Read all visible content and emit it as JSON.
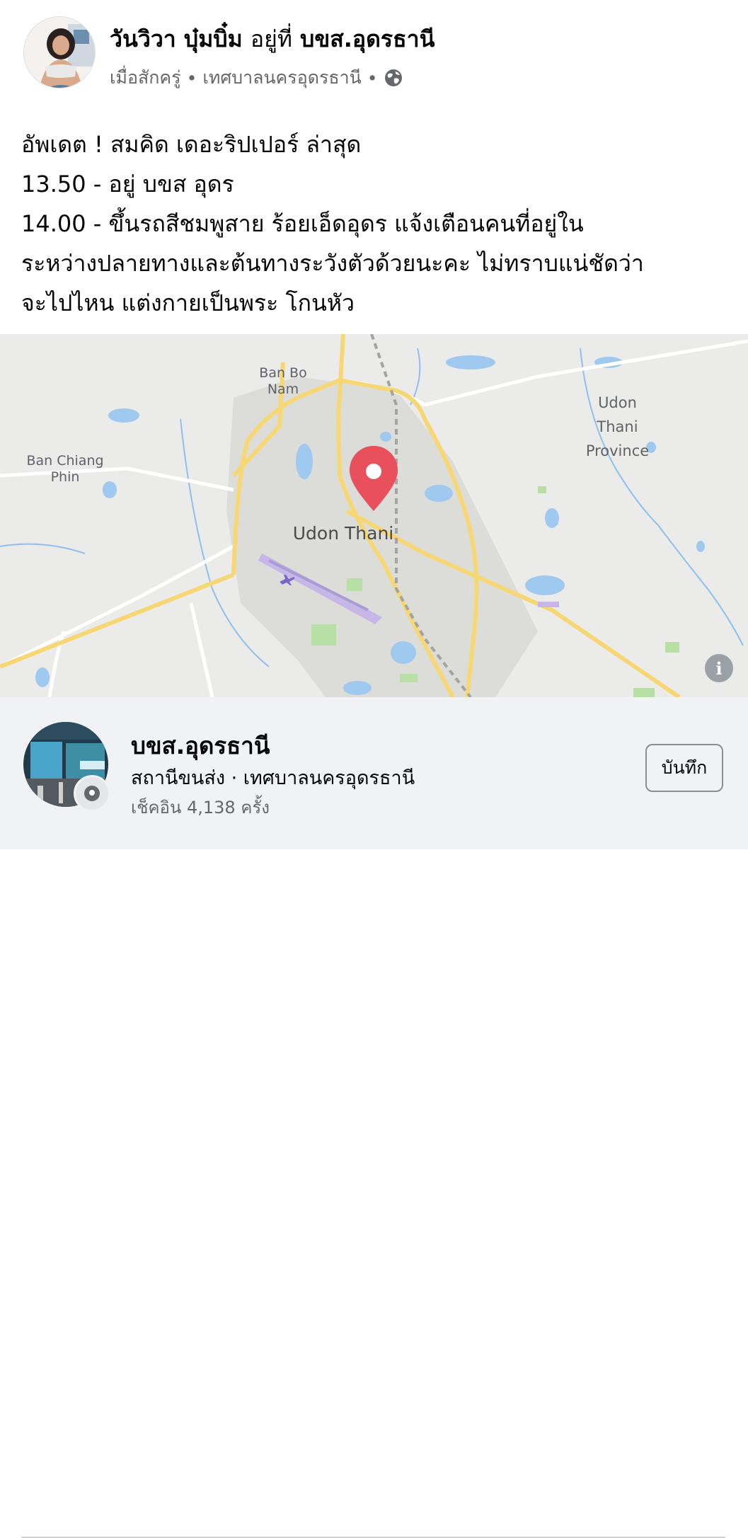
{
  "post": {
    "author": "วันวิวา บุ๋มบิ๋ม",
    "location_prefix": "อยู่ที่",
    "location_name": "บขส.อุดรธานี",
    "time": "เมื่อสักครู่",
    "place": "เทศบาลนครอุดรธานี",
    "separator": "•",
    "privacy_icon": "globe-icon",
    "text_lines": [
      "อัพเดต ! สมคิด เดอะริปเปอร์ ล่าสุด",
      "13.50 - อยู่ บขส อุดร",
      "14.00 - ขึ้นรถสีชมพูสาย ร้อยเอ็ดอุดร แจ้งเตือนคนที่อยู่ใน",
      "ระหว่างปลายทางและต้นทางระวังตัวด้วยนะคะ ไม่ทราบแน่ชัดว่า",
      "จะไปไหน แต่งกายเป็นพระ โกนหัว"
    ]
  },
  "map": {
    "labels": {
      "ban_bo_nam": "Ban Bo\nNam",
      "ban_chiang_phin": "Ban Chiang\nPhin",
      "udon_thani": "Udon Thani",
      "province": "Udon\nThani\nProvince"
    },
    "pin_color": "#e8505b",
    "info_label": "i"
  },
  "place_card": {
    "name": "บขส.อุดรธานี",
    "category_line": "สถานีขนส่ง · เทศบาลนครอุดรธานี",
    "checkins": "เช็คอิน 4,138 ครั้ง",
    "save_label": "บันทึก"
  }
}
